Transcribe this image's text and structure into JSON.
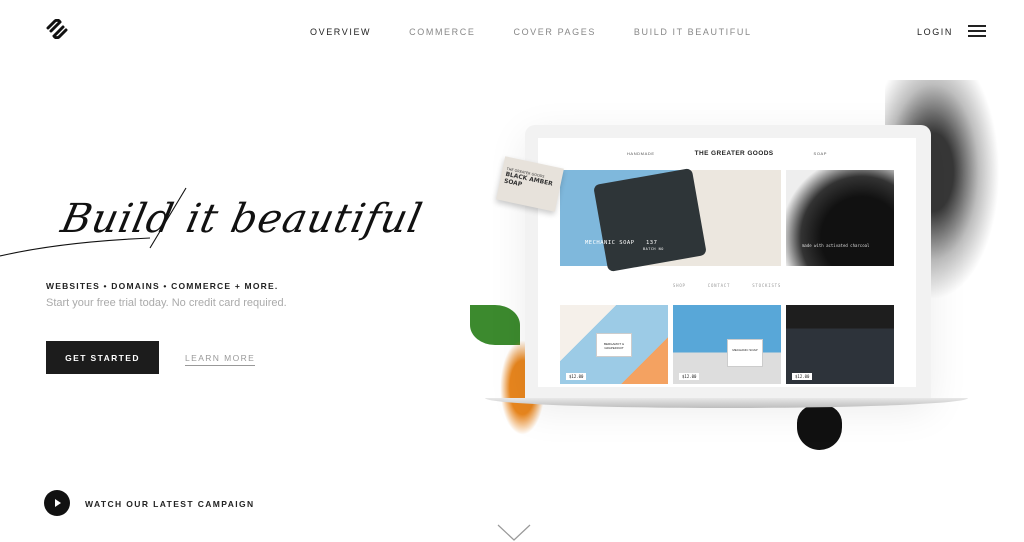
{
  "nav": {
    "items": [
      {
        "label": "OVERVIEW",
        "active": true
      },
      {
        "label": "COMMERCE"
      },
      {
        "label": "COVER PAGES"
      },
      {
        "label": "BUILD IT BEAUTIFUL"
      }
    ],
    "login": "LOGIN",
    "menu_icon": "hamburger-icon",
    "logo_icon": "squarespace-logo"
  },
  "hero": {
    "script_title": "Build it beautiful",
    "tagline": "WEBSITES • DOMAINS • COMMERCE + MORE.",
    "subtitle": "Start your free trial today. No credit card required.",
    "cta": "GET STARTED",
    "learn_more": "LEARN MORE",
    "campaign": "WATCH OUR LATEST CAMPAIGN",
    "scroll_icon": "chevron-down-icon"
  },
  "mockup": {
    "nav_left": "HANDMADE",
    "brand": "THE GREATER GOODS",
    "nav_right": "SOAP",
    "hero1_text": "MECHANIC SOAP",
    "hero1_num": "137",
    "hero1_sub": "BATCH NO",
    "hero2_text": "made with   activated charcoal",
    "links": [
      "SHOP",
      "CONTACT",
      "STOCKISTS"
    ],
    "product_tags": [
      "BERGAMOT & GRAPEFRUIT",
      "MECHANIC SOAP"
    ],
    "prices": [
      "$12.00",
      "$12.00",
      "$12.00"
    ],
    "card_brand": "THE GREATER GOODS",
    "card_title": "BLACK AMBER SOAP"
  }
}
